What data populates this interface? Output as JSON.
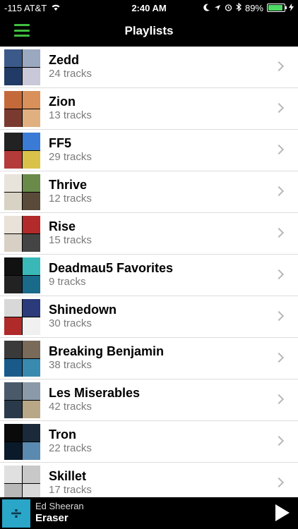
{
  "status_bar": {
    "carrier": "-115 AT&T",
    "time": "2:40 AM",
    "battery_percent": "89%",
    "battery_level": 0.89,
    "icons": [
      "wifi-icon",
      "moon-icon",
      "location-icon",
      "alarm-icon",
      "bluetooth-icon",
      "charging-icon"
    ]
  },
  "nav": {
    "title": "Playlists",
    "menu_icon": "hamburger-menu-icon",
    "accent_color": "#3fbf3f"
  },
  "playlists": [
    {
      "name": "Zedd",
      "tracks": "24 tracks",
      "art_colors": [
        "#3b5a8a",
        "#9aa8c0",
        "#213a66",
        "#c8c8d8"
      ]
    },
    {
      "name": "Zion",
      "tracks": "13 tracks",
      "art_colors": [
        "#c46a3a",
        "#d9905a",
        "#7a3a30",
        "#e0b080"
      ]
    },
    {
      "name": "FF5",
      "tracks": "29 tracks",
      "art_colors": [
        "#222222",
        "#3a7bd5",
        "#b53a3a",
        "#d9c24a"
      ]
    },
    {
      "name": "Thrive",
      "tracks": "12 tracks",
      "art_colors": [
        "#e8e4dc",
        "#6a8a4a",
        "#d8d2c4",
        "#5a4a3a"
      ]
    },
    {
      "name": "Rise",
      "tracks": "15 tracks",
      "art_colors": [
        "#e8e2d8",
        "#b22a2a",
        "#d8d0c4",
        "#444444"
      ]
    },
    {
      "name": "Deadmau5 Favorites",
      "tracks": "9 tracks",
      "art_colors": [
        "#111111",
        "#3ab8b8",
        "#222222",
        "#1a6a8a"
      ]
    },
    {
      "name": "Shinedown",
      "tracks": "30 tracks",
      "art_colors": [
        "#d8d8d8",
        "#2a3a7a",
        "#b02a2a",
        "#f0f0f0"
      ]
    },
    {
      "name": "Breaking Benjamin",
      "tracks": "38 tracks",
      "art_colors": [
        "#3a3a3a",
        "#7a6a5a",
        "#1a5a8a",
        "#3a8ab0"
      ]
    },
    {
      "name": "Les Miserables",
      "tracks": "42 tracks",
      "art_colors": [
        "#4a5a6a",
        "#8a9aa8",
        "#2a3a4a",
        "#b8a888"
      ]
    },
    {
      "name": "Tron",
      "tracks": "22 tracks",
      "art_colors": [
        "#0a0a0a",
        "#1a2a3a",
        "#0a1a2a",
        "#5a8ab0"
      ]
    },
    {
      "name": "Skillet",
      "tracks": "17 tracks",
      "art_colors": [
        "#e0e0e0",
        "#c8c8c8",
        "#b8b8b8",
        "#d8d8d8"
      ]
    }
  ],
  "now_playing": {
    "artist": "Ed Sheeran",
    "track": "Eraser",
    "art_symbol": "÷",
    "art_color": "#2aa6c9"
  }
}
